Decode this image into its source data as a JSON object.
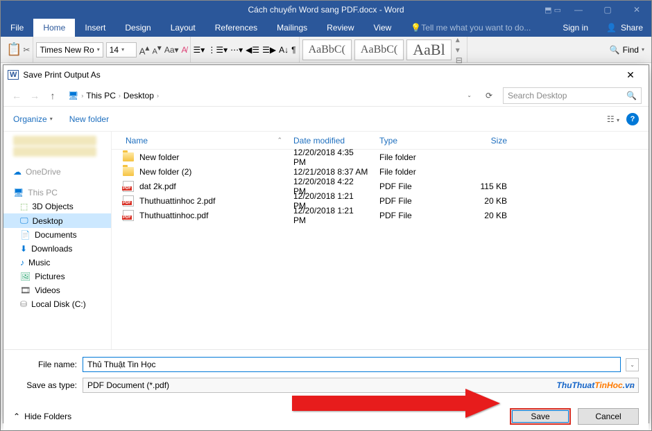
{
  "word": {
    "title": "Cách chuyển Word sang PDF.docx - Word",
    "win_mini": "⬒ ▭",
    "tabs": {
      "file": "File",
      "home": "Home",
      "insert": "Insert",
      "design": "Design",
      "layout": "Layout",
      "references": "References",
      "mailings": "Mailings",
      "review": "Review",
      "view": "View",
      "tell": "Tell me what you want to do...",
      "signin": "Sign in",
      "share": "Share"
    },
    "ribbon": {
      "font_name": "Times New Ro",
      "font_size": "14",
      "style1": "AaBbC(",
      "style2": "AaBbC(",
      "style3": "AaBl",
      "find": "Find"
    }
  },
  "dialog": {
    "title": "Save Print Output As",
    "breadcrumb": {
      "root": "This PC",
      "folder": "Desktop"
    },
    "search_placeholder": "Search Desktop",
    "toolbar": {
      "organize": "Organize",
      "newfolder": "New folder"
    },
    "columns": {
      "name": "Name",
      "date": "Date modified",
      "type": "Type",
      "size": "Size"
    },
    "sidebar": {
      "onedrive": "OneDrive",
      "thispc": "This PC",
      "objects3d": "3D Objects",
      "desktop": "Desktop",
      "documents": "Documents",
      "downloads": "Downloads",
      "music": "Music",
      "pictures": "Pictures",
      "videos": "Videos",
      "localdisk": "Local Disk (C:)"
    },
    "files": [
      {
        "icon": "folder",
        "name": "New folder",
        "date": "12/20/2018 4:35 PM",
        "type": "File folder",
        "size": ""
      },
      {
        "icon": "folder",
        "name": "New folder (2)",
        "date": "12/21/2018 8:37 AM",
        "type": "File folder",
        "size": ""
      },
      {
        "icon": "pdf",
        "name": "dat 2k.pdf",
        "date": "12/20/2018 4:22 PM",
        "type": "PDF File",
        "size": "115 KB"
      },
      {
        "icon": "pdf",
        "name": "Thuthuattinhoc 2.pdf",
        "date": "12/20/2018 1:21 PM",
        "type": "PDF File",
        "size": "20 KB"
      },
      {
        "icon": "pdf",
        "name": "Thuthuattinhoc.pdf",
        "date": "12/20/2018 1:21 PM",
        "type": "PDF File",
        "size": "20 KB"
      }
    ],
    "filename_label": "File name:",
    "filename_value": "Thủ Thuật Tin Học",
    "savetype_label": "Save as type:",
    "savetype_value": "PDF Document (*.pdf)",
    "hide_folders": "Hide Folders",
    "save": "Save",
    "cancel": "Cancel"
  },
  "watermark": {
    "p1": "ThuThuat",
    "p2": "TinHoc",
    "p3": ".vn"
  }
}
